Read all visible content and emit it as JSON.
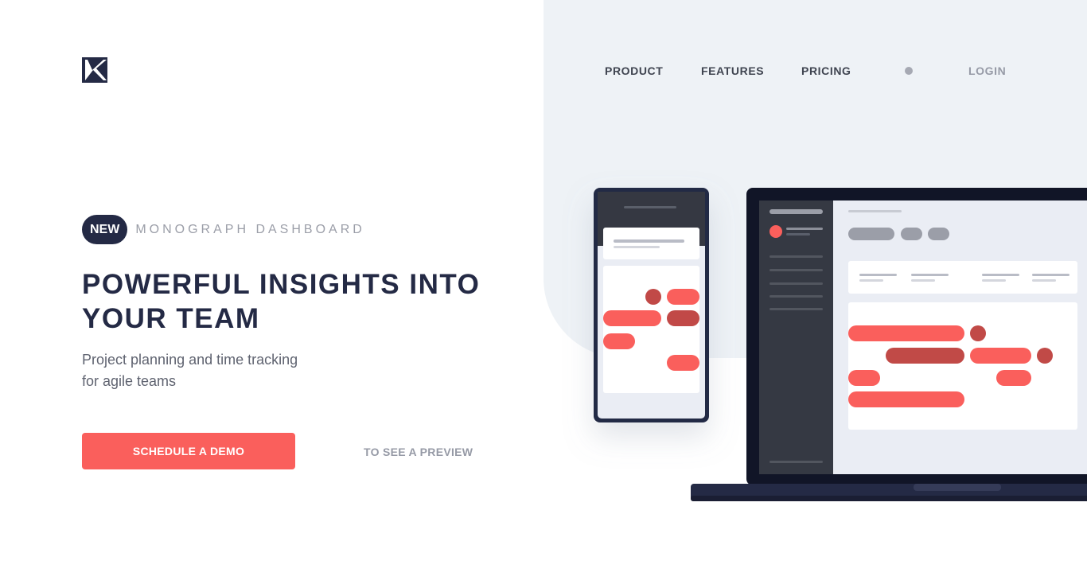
{
  "brand": {
    "logo_icon": "monograph-k-logo-icon"
  },
  "nav": {
    "items": [
      {
        "label": "PRODUCT"
      },
      {
        "label": "FEATURES"
      },
      {
        "label": "PRICING"
      }
    ],
    "login_label": "LOGIN"
  },
  "hero": {
    "badge": "NEW",
    "tagline": "MONOGRAPH DASHBOARD",
    "title_line1": "POWERFUL INSIGHTS INTO",
    "title_line2": "YOUR TEAM",
    "subtitle_line1": "Project planning and time tracking",
    "subtitle_line2": "for agile teams",
    "cta_label": "SCHEDULE A DEMO",
    "secondary_label": "TO SEE A PREVIEW"
  },
  "colors": {
    "accent": "#fa5f5c",
    "accent_dark": "#c14a47",
    "navy": "#242a45",
    "panel_bg": "#eef2f6"
  },
  "illustration": {
    "devices": [
      "phone",
      "laptop"
    ]
  }
}
